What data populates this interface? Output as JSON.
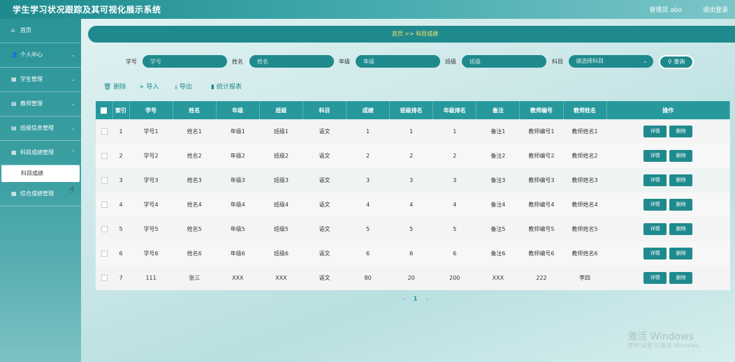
{
  "header": {
    "title": "学生学习状况跟踪及其可视化展示系统",
    "user": "管理员 abo",
    "logout": "退出登录"
  },
  "sidebar": {
    "items": [
      {
        "label": "首页",
        "icon": "home-icon",
        "glyph": "⌂",
        "chevron": false
      },
      {
        "label": "个人中心",
        "icon": "user-icon",
        "glyph": "👤",
        "chevron": true
      },
      {
        "label": "学生管理",
        "icon": "grid-icon",
        "glyph": "▦",
        "chevron": true
      },
      {
        "label": "教师管理",
        "icon": "document-icon",
        "glyph": "▤",
        "chevron": true
      },
      {
        "label": "班级信息管理",
        "icon": "document-icon",
        "glyph": "▤",
        "chevron": true
      },
      {
        "label": "科目成绩管理",
        "icon": "grid-icon",
        "glyph": "▦",
        "chevron": true
      }
    ],
    "active_sub": "科目成绩",
    "last_item": {
      "label": "综合成绩管理",
      "icon": "grid-icon",
      "glyph": "▦"
    }
  },
  "breadcrumb": {
    "home": "首页",
    "sep": ">>",
    "current": "科目成绩"
  },
  "search": {
    "student_no_label": "学号",
    "student_no_placeholder": "学号",
    "name_label": "姓名",
    "name_placeholder": "姓名",
    "grade_label": "年级",
    "grade_placeholder": "年级",
    "class_label": "班级",
    "class_placeholder": "班级",
    "subject_label": "科目",
    "subject_placeholder": "请选择科目",
    "query_button": "查询"
  },
  "actions": {
    "delete": "删除",
    "import": "导入",
    "export": "导出",
    "report": "统计报表"
  },
  "table": {
    "headers": [
      "索引",
      "学号",
      "姓名",
      "年级",
      "班级",
      "科目",
      "成绩",
      "班级排名",
      "年级排名",
      "备注",
      "教师编号",
      "教师姓名",
      "操作"
    ],
    "detail_label": "详情",
    "delete_label": "删除",
    "rows": [
      [
        "1",
        "学号1",
        "姓名1",
        "年级1",
        "班级1",
        "语文",
        "1",
        "1",
        "1",
        "备注1",
        "教师编号1",
        "教师姓名1"
      ],
      [
        "2",
        "学号2",
        "姓名2",
        "年级2",
        "班级2",
        "语文",
        "2",
        "2",
        "2",
        "备注2",
        "教师编号2",
        "教师姓名2"
      ],
      [
        "3",
        "学号3",
        "姓名3",
        "年级3",
        "班级3",
        "语文",
        "3",
        "3",
        "3",
        "备注3",
        "教师编号3",
        "教师姓名3"
      ],
      [
        "4",
        "学号4",
        "姓名4",
        "年级4",
        "班级4",
        "语文",
        "4",
        "4",
        "4",
        "备注4",
        "教师编号4",
        "教师姓名4"
      ],
      [
        "5",
        "学号5",
        "姓名5",
        "年级5",
        "班级5",
        "语文",
        "5",
        "5",
        "5",
        "备注5",
        "教师编号5",
        "教师姓名5"
      ],
      [
        "6",
        "学号6",
        "姓名6",
        "年级6",
        "班级6",
        "语文",
        "6",
        "6",
        "6",
        "备注6",
        "教师编号6",
        "教师姓名6"
      ],
      [
        "7",
        "111",
        "张三",
        "XXX",
        "XXX",
        "语文",
        "80",
        "20",
        "200",
        "XXX",
        "222",
        "李四"
      ]
    ]
  },
  "pager": {
    "prev": "‹",
    "current": "1",
    "next": "›"
  },
  "watermark": {
    "line1": "激活 Windows",
    "line2": "转到\"设置\"以激活 Windows。"
  },
  "colors": {
    "primary": "#1f8a8d",
    "header": "#27999c",
    "crumb_text": "#f5e26b"
  }
}
